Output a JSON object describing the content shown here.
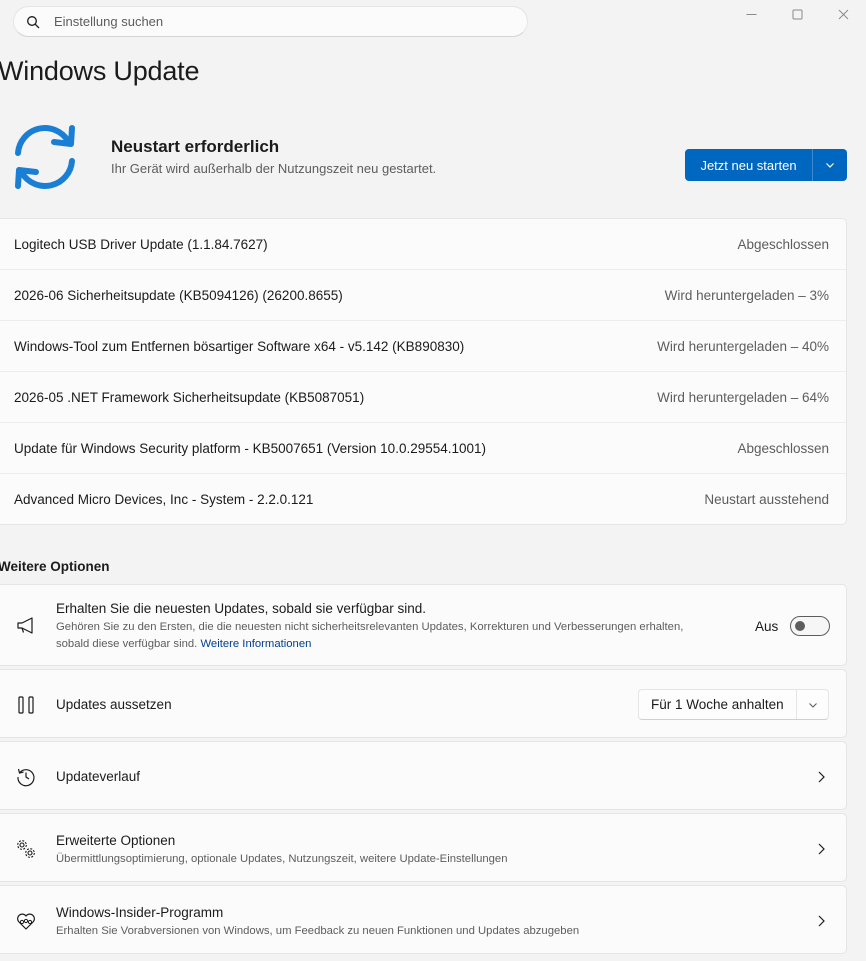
{
  "search": {
    "placeholder": "Einstellung suchen",
    "icon": "search-icon"
  },
  "window_controls": [
    "minimize-icon",
    "maximize-icon",
    "close-icon"
  ],
  "page_title": "Windows Update",
  "restart": {
    "title": "Neustart erforderlich",
    "subtitle": "Ihr Gerät wird außerhalb der Nutzungszeit neu gestartet.",
    "button_label": "Jetzt neu starten",
    "accent": "#0067c0",
    "icon": "sync-icon"
  },
  "updates": [
    {
      "name": "Logitech USB Driver Update (1.1.84.7627)",
      "status": "Abgeschlossen"
    },
    {
      "name": "2026-06 Sicherheitsupdate (KB5094126) (26200.8655)",
      "status": "Wird heruntergeladen – 3%"
    },
    {
      "name": "Windows-Tool zum Entfernen bösartiger Software x64 - v5.142 (KB890830)",
      "status": "Wird heruntergeladen – 40%"
    },
    {
      "name": "2026-05 .NET Framework Sicherheitsupdate (KB5087051)",
      "status": "Wird heruntergeladen – 64%"
    },
    {
      "name": "Update für Windows Security platform - KB5007651 (Version 10.0.29554.1001)",
      "status": "Abgeschlossen"
    },
    {
      "name": "Advanced Micro Devices, Inc - System - 2.2.0.121",
      "status": "Neustart ausstehend"
    }
  ],
  "more_options": {
    "heading": "Weitere Optionen",
    "latest": {
      "title": "Erhalten Sie die neuesten Updates, sobald sie verfügbar sind.",
      "desc_line1": "Gehören Sie zu den Ersten, die die neuesten nicht sicherheitsrelevanten Updates, Korrekturen und Verbesserungen erhalten,",
      "desc_line2": "sobald diese verfügbar sind.",
      "link": "Weitere Informationen",
      "toggle_label": "Aus",
      "toggle_on": false,
      "icon": "megaphone-icon"
    },
    "pause": {
      "title": "Updates aussetzen",
      "dropdown_value": "Für 1 Woche anhalten",
      "icon": "pause-icon"
    },
    "history": {
      "title": "Updateverlauf",
      "icon": "history-icon"
    },
    "advanced": {
      "title": "Erweiterte Optionen",
      "desc": "Übermittlungsoptimierung, optionale Updates, Nutzungszeit, weitere Update-Einstellungen",
      "icon": "gears-icon"
    },
    "insider": {
      "title": "Windows-Insider-Programm",
      "desc": "Erhalten Sie Vorabversionen von Windows, um Feedback zu neuen Funktionen und Updates abzugeben",
      "icon": "insider-icon"
    }
  }
}
